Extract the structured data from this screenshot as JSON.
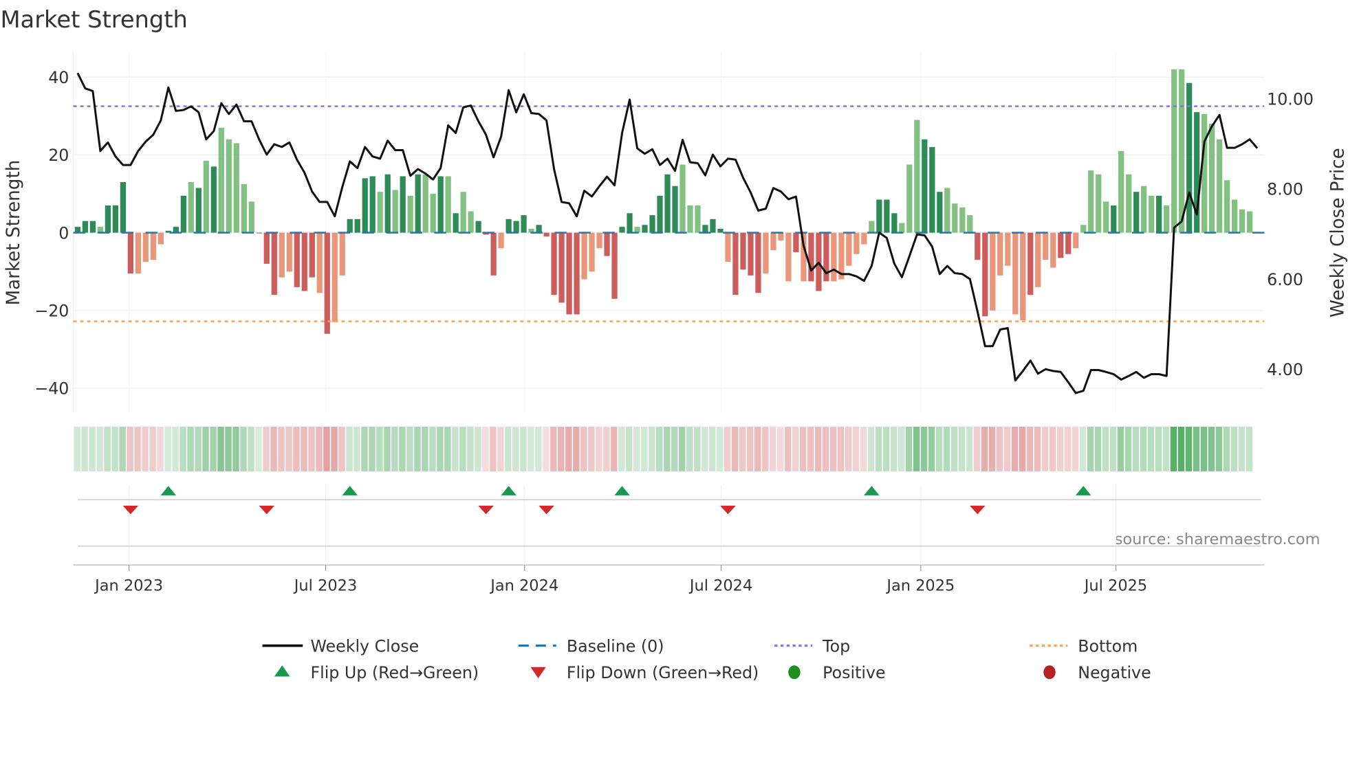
{
  "chart_data": {
    "type": "bar",
    "title": "Market Strength",
    "ylabel": "Market Strength",
    "y2label": "Weekly Close Price",
    "ylim": [
      -46,
      46
    ],
    "y2lim": [
      3.2,
      10.9
    ],
    "yticks": [
      40,
      20,
      0,
      -20,
      -40
    ],
    "yticklabels": [
      "40",
      "20",
      "0",
      "−20",
      "−40"
    ],
    "y2ticks": [
      10,
      8,
      6,
      4
    ],
    "y2ticklabels": [
      "10.00",
      "8.00",
      "6.00",
      "4.00"
    ],
    "xtick_labels": [
      "Jan 2023",
      "Jul 2023",
      "Jan 2024",
      "Jul 2024",
      "Jan 2025",
      "Jul 2025"
    ],
    "xtick_week_index": [
      6.8,
      32.8,
      59.1,
      85.1,
      111.5,
      137.3
    ],
    "top_level": 32.5,
    "bottom_level": -22.8,
    "baseline": 0,
    "grid": true,
    "strength": [
      1.5,
      3,
      3,
      1.5,
      7,
      7,
      13,
      -10.5,
      -10.5,
      -7.5,
      -7,
      -3,
      0.5,
      1.5,
      9.5,
      13,
      11.5,
      18.5,
      17,
      27,
      24,
      23,
      12.5,
      8,
      0,
      -8,
      -16,
      -11.5,
      -10,
      -14,
      -15,
      -11.5,
      -15.5,
      -26,
      -23,
      -11,
      3.5,
      3.5,
      14,
      14.5,
      10.5,
      15,
      11,
      14.5,
      9.5,
      15,
      15,
      10,
      14.5,
      14.5,
      5,
      10.5,
      5.5,
      3,
      -0.5,
      -11,
      -4,
      3.5,
      3,
      4.5,
      1,
      2,
      -1,
      -16,
      -18,
      -21,
      -21,
      -12,
      -10,
      -4,
      -6,
      -17,
      1.5,
      5,
      1.5,
      2,
      4.5,
      9.5,
      15,
      12,
      17.5,
      7,
      7,
      2,
      3.5,
      1,
      -7.5,
      -16,
      -9.5,
      -11,
      -15.5,
      -10.5,
      -4.5,
      -2,
      -12.5,
      -5,
      -12.5,
      -12.5,
      -15,
      -12.5,
      -12.5,
      -12,
      -8.5,
      -5.5,
      -3,
      3,
      8.5,
      8.5,
      5,
      2.5,
      17.5,
      29,
      24,
      22,
      10.5,
      11.5,
      7.5,
      6.5,
      4.5,
      -7,
      -21.5,
      -20,
      -11,
      -8.5,
      -21,
      -22.5,
      -16,
      -14,
      -7,
      -9,
      -6.5,
      -5.5,
      -4,
      2,
      16,
      15,
      8,
      7,
      21,
      15,
      10.5,
      12,
      9.5,
      9.5,
      7,
      42,
      42,
      38.5,
      31,
      30.5,
      28,
      24,
      13.5,
      8.5,
      6,
      5.5
    ],
    "shade": "dddlddddlllldddldldllllldddlldddldllddddldldldlldldlldddldddlddddddlllddddldddddllldddlddddlllldldddlllllldddllldddllllddllllldlllddllllldlldlldlllddllllllll",
    "weekly_close": [
      10.57,
      10.23,
      10.17,
      8.84,
      9.03,
      8.72,
      8.53,
      8.53,
      8.84,
      9.05,
      9.2,
      9.52,
      10.25,
      9.73,
      9.75,
      9.83,
      9.7,
      9.1,
      9.28,
      9.9,
      9.66,
      9.87,
      9.5,
      9.5,
      9.1,
      8.76,
      8.99,
      8.93,
      9.03,
      8.65,
      8.36,
      7.94,
      7.71,
      7.71,
      7.39,
      8.04,
      8.61,
      8.46,
      8.93,
      8.72,
      8.67,
      9.07,
      8.86,
      8.86,
      8.29,
      8.44,
      8.34,
      8.21,
      8.46,
      9.41,
      9.24,
      9.81,
      9.85,
      9.5,
      9.2,
      8.7,
      9.16,
      10.19,
      9.7,
      10.1,
      9.68,
      9.66,
      9.52,
      8.44,
      7.71,
      7.68,
      7.39,
      7.96,
      7.83,
      8.06,
      8.27,
      8.08,
      9.24,
      9.98,
      8.9,
      8.78,
      8.88,
      8.53,
      8.67,
      8.4,
      9.09,
      8.59,
      8.57,
      8.3,
      8.76,
      8.5,
      8.67,
      8.65,
      8.25,
      7.92,
      7.52,
      7.56,
      8.02,
      7.94,
      7.77,
      7.83,
      6.74,
      6.19,
      6.36,
      6.13,
      6.21,
      6.11,
      6.11,
      6.06,
      5.96,
      6.29,
      7.03,
      6.91,
      6.34,
      6.04,
      6.51,
      6.99,
      6.97,
      6.72,
      6.11,
      6.29,
      6.13,
      6.11,
      6.0,
      5.28,
      4.51,
      4.51,
      4.88,
      4.91,
      3.75,
      3.96,
      4.19,
      3.9,
      4.0,
      3.96,
      3.94,
      3.71,
      3.47,
      3.52,
      3.98,
      3.98,
      3.94,
      3.89,
      3.77,
      3.85,
      3.94,
      3.81,
      3.89,
      3.89,
      3.85,
      7.14,
      7.28,
      7.92,
      7.43,
      9.05,
      9.39,
      9.64,
      8.91,
      8.91,
      8.99,
      9.1,
      8.9
    ],
    "flip_up_week_index": [
      12,
      36,
      57,
      72,
      105,
      133
    ],
    "flip_down_week_index": [
      7,
      25,
      54,
      62,
      86,
      119
    ],
    "legend": {
      "placement": "bottom",
      "items": [
        {
          "label": "Weekly Close",
          "kind": "line",
          "color": "#111111"
        },
        {
          "label": "Baseline (0)",
          "kind": "dash",
          "color": "#1f77b4"
        },
        {
          "label": "Top",
          "kind": "dot",
          "color": "#9370db"
        },
        {
          "label": "Bottom",
          "kind": "dot",
          "color": "#f4a460"
        },
        {
          "label": "Flip Up (Red→Green)",
          "kind": "tri-up",
          "color": "#1a9850"
        },
        {
          "label": "Flip Down (Green→Red)",
          "kind": "tri-down",
          "color": "#d62728"
        },
        {
          "label": "Positive",
          "kind": "circle",
          "color": "#228b22"
        },
        {
          "label": "Negative",
          "kind": "circle",
          "color": "#b22222"
        }
      ]
    },
    "annotation": "source: sharemaestro.com",
    "colors": {
      "pos_dark": "#2e8b57",
      "pos_light": "#82c182",
      "neg_dark": "#cd5c5c",
      "neg_light": "#e9967a"
    }
  }
}
